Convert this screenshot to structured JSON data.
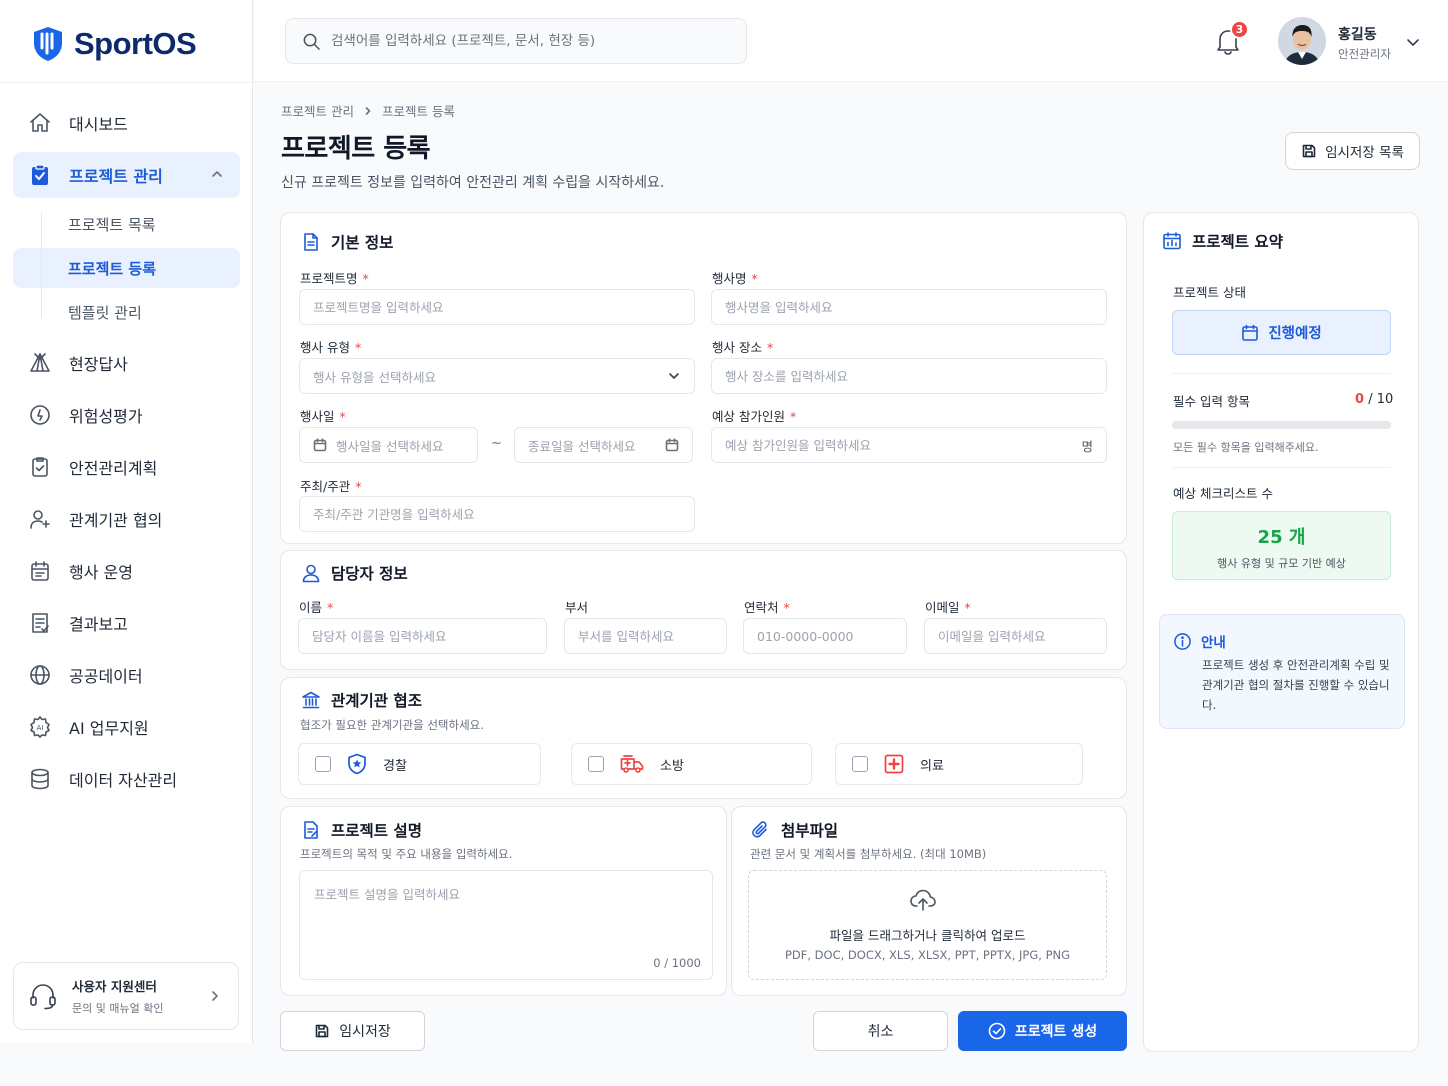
{
  "app": {
    "name": "SportOS"
  },
  "header": {
    "search_placeholder": "검색어를 입력하세요 (프로젝트, 문서, 현장 등)",
    "notifications_count": "3",
    "user": {
      "name": "홍길동",
      "role": "안전관리자"
    }
  },
  "sidebar": {
    "items": [
      {
        "label": "대시보드",
        "icon": "home-icon"
      },
      {
        "label": "프로젝트 관리",
        "icon": "clipboard-check-icon",
        "active": true,
        "children": [
          {
            "label": "프로젝트 목록"
          },
          {
            "label": "프로젝트 등록",
            "active": true
          },
          {
            "label": "템플릿 관리"
          }
        ]
      },
      {
        "label": "현장답사",
        "icon": "tent-icon"
      },
      {
        "label": "위험성평가",
        "icon": "alert-circle-icon"
      },
      {
        "label": "안전관리계획",
        "icon": "clipboard-list-icon"
      },
      {
        "label": "관계기관 협의",
        "icon": "user-plus-icon"
      },
      {
        "label": "행사 운영",
        "icon": "calendar-icon"
      },
      {
        "label": "결과보고",
        "icon": "report-icon"
      },
      {
        "label": "공공데이터",
        "icon": "globe-icon"
      },
      {
        "label": "AI 업무지원",
        "icon": "ai-gear-icon"
      },
      {
        "label": "데이터 자산관리",
        "icon": "database-icon"
      }
    ],
    "support": {
      "title": "사용자 지원센터",
      "subtitle": "문의 및 매뉴얼 확인"
    }
  },
  "page": {
    "breadcrumb": [
      "프로젝트 관리",
      "프로젝트 등록"
    ],
    "title": "프로젝트 등록",
    "description": "신규 프로젝트 정보를 입력하여 안전관리 계획 수립을 시작하세요.",
    "draft_list_label": "임시저장 목록"
  },
  "basic_info": {
    "title": "기본 정보",
    "project_name": {
      "label": "프로젝트명",
      "placeholder": "프로젝트명을 입력하세요"
    },
    "event_name": {
      "label": "행사명",
      "placeholder": "행사명을 입력하세요"
    },
    "event_type": {
      "label": "행사 유형",
      "placeholder": "행사 유형을 선택하세요"
    },
    "venue": {
      "label": "행사 장소",
      "placeholder": "행사 장소를 입력하세요"
    },
    "event_date": {
      "label": "행사일",
      "start_placeholder": "행사일을 선택하세요",
      "separator": "~",
      "end_placeholder": "종료일을 선택하세요"
    },
    "attendees": {
      "label": "예상 참가인원",
      "placeholder": "예상 참가인원을 입력하세요",
      "suffix": "명"
    },
    "organizer": {
      "label": "주최/주관",
      "placeholder": "주최/주관 기관명을 입력하세요"
    }
  },
  "manager_info": {
    "title": "담당자 정보",
    "name": {
      "label": "이름",
      "placeholder": "담당자 이름을 입력하세요"
    },
    "department": {
      "label": "부서",
      "placeholder": "부서를 입력하세요"
    },
    "phone": {
      "label": "연락처",
      "placeholder": "010-0000-0000"
    },
    "email": {
      "label": "이메일",
      "placeholder": "이메일을 입력하세요"
    }
  },
  "agencies": {
    "title": "관계기관 협조",
    "subtitle": "협조가 필요한 관계기관을 선택하세요.",
    "options": [
      {
        "label": "경찰",
        "icon": "police-shield-icon",
        "color": "#1e5bd8"
      },
      {
        "label": "소방",
        "icon": "fire-truck-icon",
        "color": "#ef4444"
      },
      {
        "label": "의료",
        "icon": "medical-cross-icon",
        "color": "#ef4444"
      }
    ]
  },
  "description": {
    "title": "프로젝트 설명",
    "subtitle": "프로젝트의 목적 및 주요 내용을 입력하세요.",
    "placeholder": "프로젝트 설명을 입력하세요",
    "counter": "0 / 1000"
  },
  "attachments": {
    "title": "첨부파일",
    "subtitle": "관련 문서 및 계획서를 첨부하세요. (최대 10MB)",
    "dropzone_text": "파일을 드래그하거나 클릭하여 업로드",
    "formats": "PDF, DOC, DOCX, XLS, XLSX, PPT, PPTX, JPG, PNG"
  },
  "actions": {
    "save_draft": "임시저장",
    "cancel": "취소",
    "create": "프로젝트 생성"
  },
  "summary": {
    "title": "프로젝트 요약",
    "status_label": "프로젝트 상태",
    "status_value": "진행예정",
    "required_label": "필수 입력 항목",
    "required_done": "0",
    "required_total": "/ 10",
    "required_progress": 0,
    "required_hint": "모든 필수 항목을 입력해주세요.",
    "checklist_label": "예상 체크리스트 수",
    "checklist_value": "25 개",
    "checklist_hint": "행사 유형 및 규모 기반 예상"
  },
  "notice": {
    "title": "안내",
    "text": "프로젝트 생성 후 안전관리계획 수립 및 관계기관 협의 절차를 진행할 수 있습니다."
  },
  "colors": {
    "primary": "#1a66e8",
    "danger": "#ef4444",
    "success": "#16a34a",
    "brand": "#0f2a6b"
  }
}
